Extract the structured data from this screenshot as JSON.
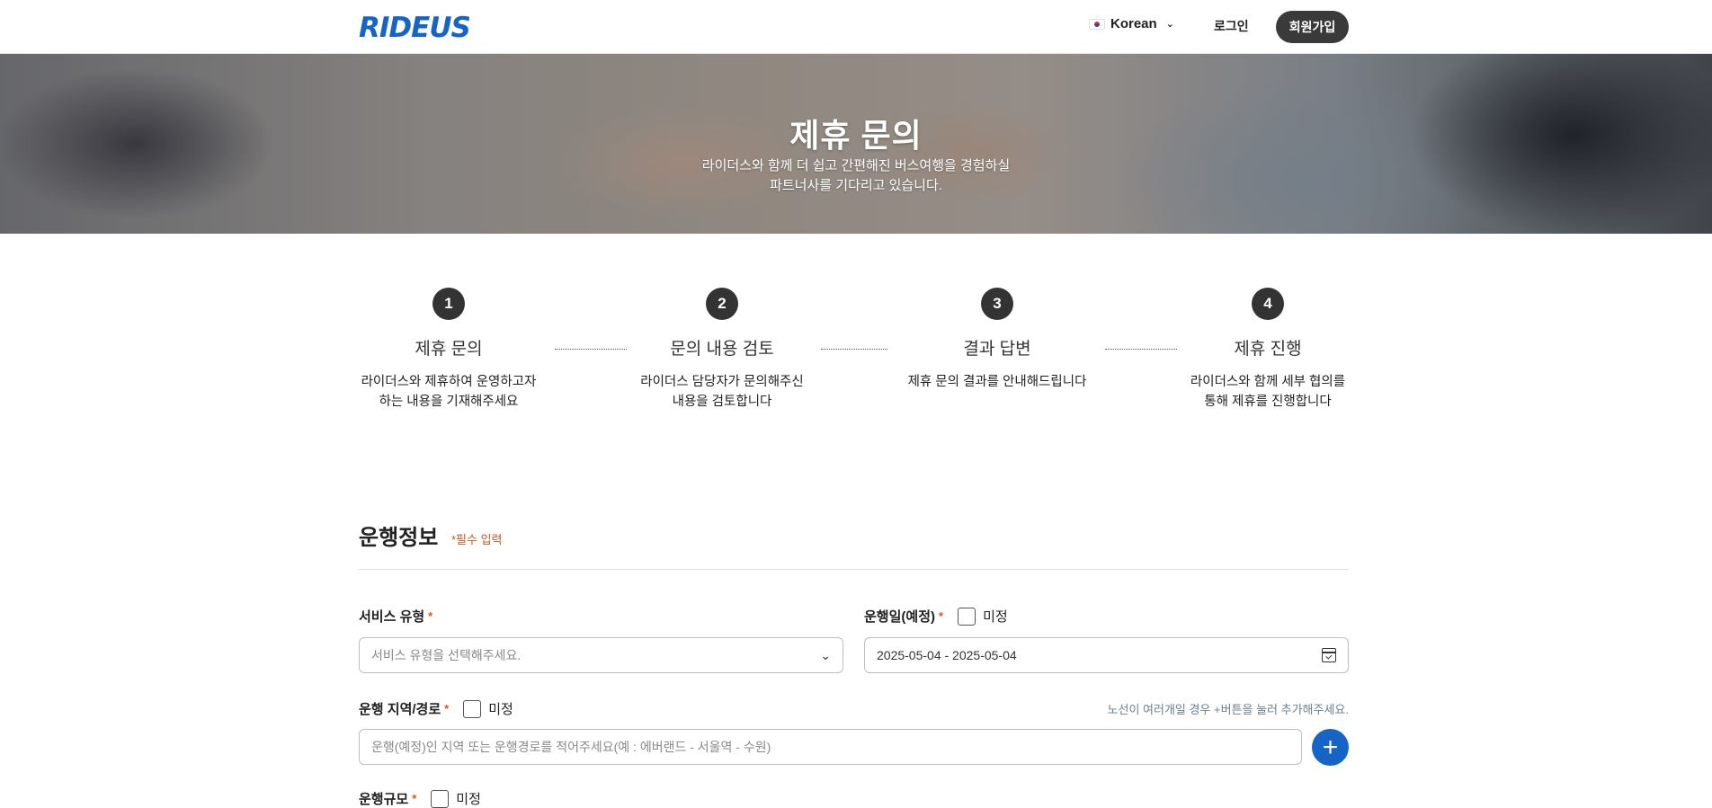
{
  "header": {
    "logo": "RIDEUS",
    "language": "Korean",
    "login": "로그인",
    "signup": "회원가입"
  },
  "hero": {
    "title": "제휴 문의",
    "subtitle_line1": "라이더스와 함께 더 쉽고 간편해진 버스여행을 경험하실",
    "subtitle_line2": "파트너사를 기다리고 있습니다."
  },
  "steps": [
    {
      "num": "1",
      "title": "제휴 문의",
      "desc1": "라이더스와 제휴하여 운영하고자",
      "desc2": "하는 내용을 기재해주세요"
    },
    {
      "num": "2",
      "title": "문의 내용 검토",
      "desc1": "라이더스 담당자가 문의해주신",
      "desc2": "내용을 검토합니다"
    },
    {
      "num": "3",
      "title": "결과 답변",
      "desc1": "제휴 문의 결과를 안내해드립니다",
      "desc2": ""
    },
    {
      "num": "4",
      "title": "제휴 진행",
      "desc1": "라이더스와 함께 세부 협의를",
      "desc2": "통해 제휴를 진행합니다"
    }
  ],
  "form": {
    "section_title": "운행정보",
    "required_note": "*필수 입력",
    "required_mark": "*",
    "service_type": {
      "label": "서비스 유형",
      "placeholder": "서비스 유형을 선택해주세요."
    },
    "run_date": {
      "label": "운행일(예정)",
      "undecided": "미정",
      "value": "2025-05-04 - 2025-05-04"
    },
    "route": {
      "label": "운행 지역/경로",
      "undecided": "미정",
      "hint": "노선이 여러개일 경우 +버튼을 눌러 추가해주세요.",
      "placeholder": "운행(예정)인 지역 또는 운행경로를 적어주세요(예 : 에버랜드 - 서울역 - 수원)"
    },
    "next_label": "운행규모",
    "next_undecided": "미정"
  },
  "colors": {
    "brand": "#1565c8",
    "dark_button": "#3a3a3a",
    "required": "#d9561c"
  }
}
